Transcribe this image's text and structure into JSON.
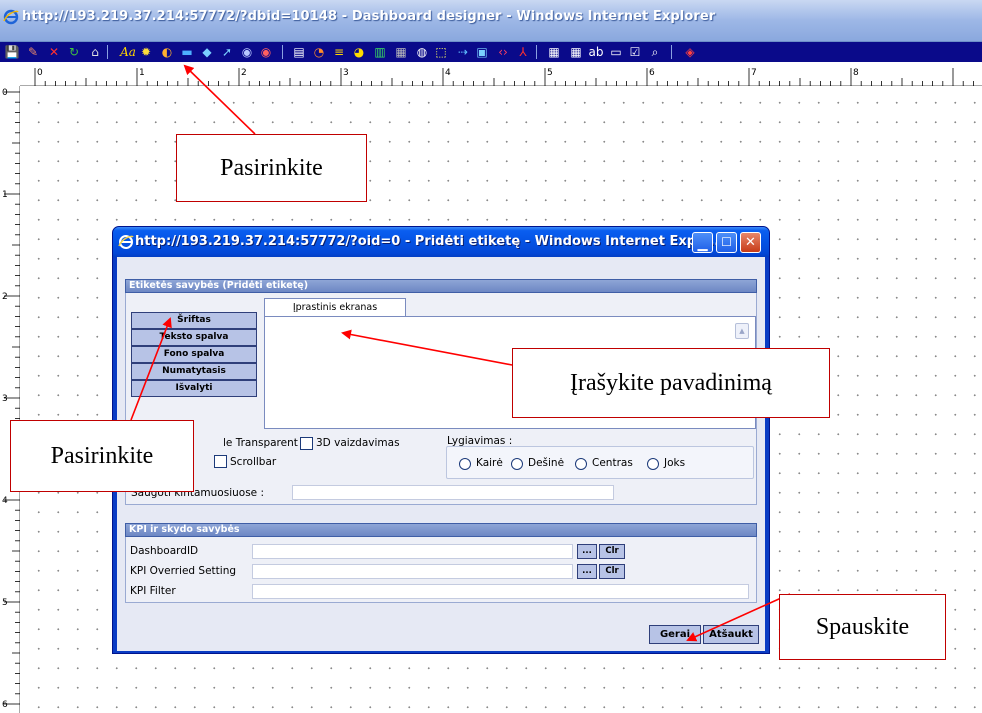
{
  "main_window": {
    "title": "http://193.219.37.214:57772/?dbid=10148 - Dashboard designer - Windows Internet Explorer"
  },
  "toolbar": {
    "icons": [
      "save-icon",
      "brush-icon",
      "delete-icon",
      "refresh-icon",
      "home-icon",
      "font-icon",
      "gear-icon",
      "palette-icon",
      "line-icon",
      "diamond-icon",
      "pointer-icon",
      "circle-icon",
      "circle-icon",
      "chart-icon",
      "gauge-icon",
      "list-icon",
      "pie-icon",
      "bar-chart-icon",
      "grid-icon",
      "globe-icon",
      "resize-icon",
      "flow-icon",
      "monitor-icon",
      "code-icon",
      "pdf-icon",
      "table-icon",
      "grid-icon",
      "textbox-icon",
      "button-icon",
      "checkbox-icon",
      "search-icon",
      "exit-icon"
    ]
  },
  "ruler": {
    "top_labels": [
      "0",
      "1",
      "2",
      "3",
      "4",
      "5",
      "6",
      "7",
      "8"
    ],
    "left_labels": [
      "0",
      "1",
      "2",
      "3",
      "4",
      "5",
      "6"
    ]
  },
  "dialog": {
    "title": "http://193.219.37.214:57772/?oid=0 - Pridėti etiketę - Windows Internet Explo...",
    "section1_title": "Etiketės savybės (Pridėti etiketę)",
    "side_buttons": [
      "Šriftas",
      "Teksto spalva",
      "Fono spalva",
      "Numatytasis",
      "Išvalyti"
    ],
    "tab_label": "Įprastinis ekranas",
    "transparent_label": "Visible Transparent",
    "transparent_label_visible": "le Transparent",
    "threed_label": "3D vaizdavimas",
    "scrollbar_label": "Scrollbar",
    "alignment_label": "Lygiavimas :",
    "alignment_options": [
      "Kairė",
      "Dešinė",
      "Centras",
      "Joks"
    ],
    "save_var_label": "Saugoti kintamuosiuose :",
    "save_var_label_visible": "Saugoti kintamuosiuose :",
    "section2_title": "KPI ir skydo savybės",
    "dashboard_id_label": "DashboardID",
    "kpi_override_label": "KPI Overried Setting",
    "kpi_filter_label": "KPI Filter",
    "dots_button": "...",
    "clr_button": "Clr",
    "ok_button": "Gerai",
    "cancel_button": "Atšaukti"
  },
  "callouts": {
    "select1": "Pasirinkite",
    "select2": "Pasirinkite",
    "enter_name": "Įrašykite pavadinimą",
    "click": "Spauskite"
  }
}
